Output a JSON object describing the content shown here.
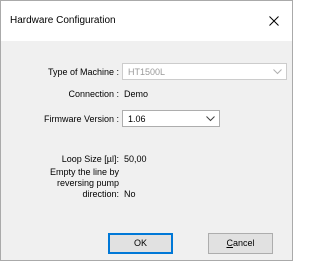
{
  "window": {
    "title": "Hardware Configuration"
  },
  "form": {
    "type_label": "Type of Machine :",
    "type_value": "HT1500L",
    "connection_label": "Connection :",
    "connection_value": "Demo",
    "firmware_label": "Firmware Version :",
    "firmware_value": "1.06",
    "loop_label": "Loop Size [µl]:",
    "loop_value": "50,00",
    "empty_line_1": "Empty the line by",
    "empty_line_2": "reversing pump",
    "empty_line_3": "direction:",
    "empty_value": "No"
  },
  "buttons": {
    "ok": "OK",
    "cancel_mnemonic": "C",
    "cancel_rest": "ancel"
  },
  "colors": {
    "focus_accent": "#0078d7",
    "dialog_background": "#f0f0f0",
    "disabled_text": "#9a9a9a"
  },
  "icons": {
    "close": "close-icon",
    "dropdown": "chevron-down-icon"
  }
}
